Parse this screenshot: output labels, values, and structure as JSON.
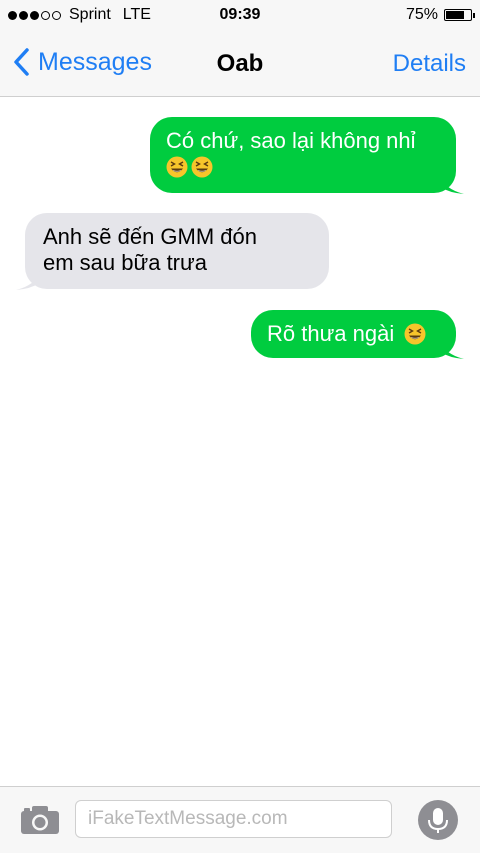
{
  "status_bar": {
    "carrier": "Sprint",
    "network": "LTE",
    "time": "09:39",
    "battery_percent_text": "75%",
    "battery_level": 0.75,
    "signal_bars_filled": 3,
    "signal_bars_total": 5
  },
  "nav": {
    "back_label": "Messages",
    "title": "Oab",
    "details_label": "Details"
  },
  "messages": [
    {
      "direction": "sent",
      "lines": [
        "Có chứ, sao lại không nhỉ",
        ""
      ],
      "emoji_count_line2": 2
    },
    {
      "direction": "received",
      "lines": [
        "Anh sẽ đến GMM đón",
        "em sau bữa trưa"
      ]
    },
    {
      "direction": "sent",
      "lines": [
        "Rõ thưa ngài"
      ],
      "emoji_count_line1": 1
    }
  ],
  "input": {
    "placeholder": "iFakeTextMessage.com"
  },
  "icons": {
    "back": "chevron-left-icon",
    "camera": "camera-icon",
    "mic": "microphone-icon",
    "emoji": "laughing-face-emoji"
  },
  "colors": {
    "accent": "#1f7ef4",
    "sent_bubble": "#00cc3f",
    "received_bubble": "#e5e5ea"
  }
}
